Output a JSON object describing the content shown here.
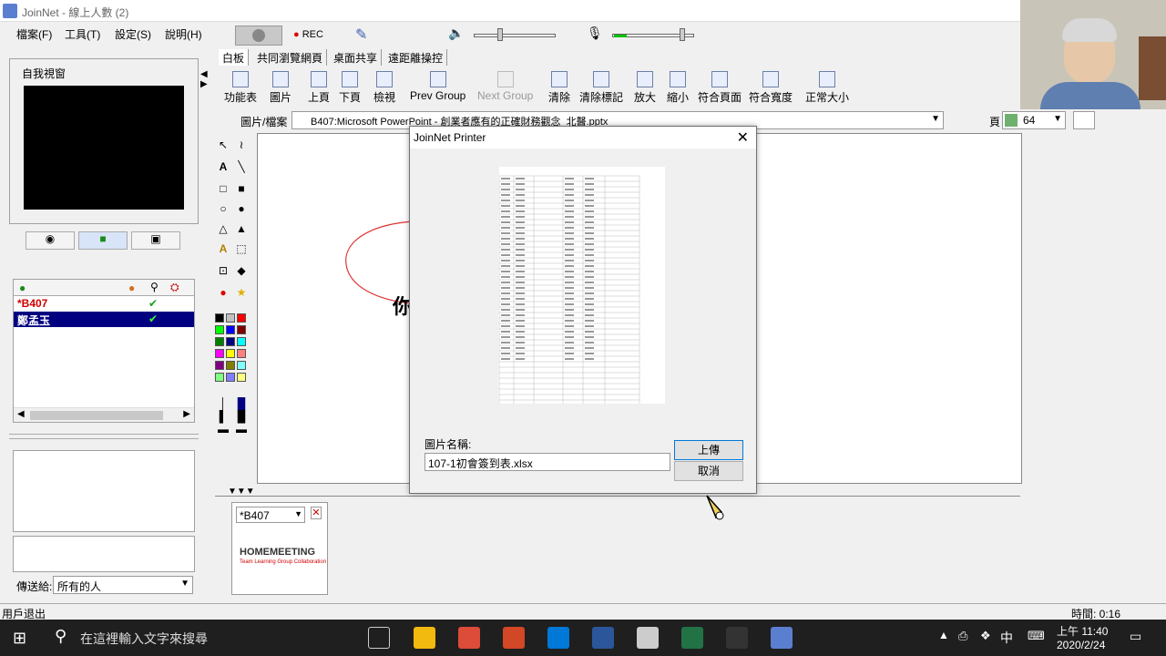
{
  "window": {
    "title": "JoinNet - 線上人數 (2)"
  },
  "menu": [
    "檔案(F)",
    "工具(T)",
    "設定(S)",
    "說明(H)"
  ],
  "toolbar": {
    "rec_label": "REC"
  },
  "tabs": [
    "白板",
    "共同瀏覽網頁",
    "桌面共享",
    "遠距離操控"
  ],
  "ribbon": [
    {
      "label": "功能表"
    },
    {
      "label": "圖片"
    },
    {
      "label": "上頁"
    },
    {
      "label": "下頁"
    },
    {
      "label": "檢視"
    },
    {
      "label": "Prev Group"
    },
    {
      "label": "Next Group",
      "disabled": true
    },
    {
      "label": "清除"
    },
    {
      "label": "清除標記"
    },
    {
      "label": "放大"
    },
    {
      "label": "縮小"
    },
    {
      "label": "符合頁面"
    },
    {
      "label": "符合寬度"
    },
    {
      "label": "正常大小"
    }
  ],
  "filebar": {
    "label": "圖片/檔案",
    "value": "B407:Microsoft PowerPoint - 創業者應有的正確財務觀念_北醫.pptx",
    "page_label": "頁",
    "page_value": "64"
  },
  "left": {
    "self_view_label": "自我視窗",
    "users": [
      {
        "name": "*B407",
        "check": "✔",
        "color": "#d00000",
        "selected": false
      },
      {
        "name": "鄭孟玉",
        "check": "✔",
        "color": "#ffffff",
        "selected": true
      }
    ],
    "send_to_label": "傳送給:",
    "send_to_value": "所有的人"
  },
  "canvas": {
    "partial_text": "你"
  },
  "bottom": {
    "user_select": "*B407",
    "logo_text": "HOMEMEETING",
    "logo_tagline": "Team Learning  Group Collaboration"
  },
  "status": {
    "left": "用戶退出",
    "right": "時間: 0:16"
  },
  "dialog": {
    "title": "JoinNet Printer",
    "name_label": "圖片名稱:",
    "name_value": "107-1初會簽到表.xlsx",
    "upload_label": "上傳",
    "cancel_label": "取消"
  },
  "taskbar": {
    "search_placeholder": "在這裡輸入文字來搜尋",
    "ime": "中",
    "time": "上午 11:40",
    "date": "2020/2/24",
    "app_icons": [
      {
        "name": "task-view-icon",
        "color": "#1f1f1f"
      },
      {
        "name": "file-explorer-icon",
        "color": "#f2b90f"
      },
      {
        "name": "chrome-icon",
        "color": "#dd4b39"
      },
      {
        "name": "powerpoint-icon",
        "color": "#d24726"
      },
      {
        "name": "store-icon",
        "color": "#0078d7"
      },
      {
        "name": "word-icon",
        "color": "#2b579a"
      },
      {
        "name": "mail-icon",
        "color": "#cccccc"
      },
      {
        "name": "excel-icon",
        "color": "#217346"
      },
      {
        "name": "7zip-icon",
        "color": "#333333"
      },
      {
        "name": "joinnet-icon",
        "color": "#5a7fd1"
      }
    ]
  },
  "palette": [
    "#000000",
    "#c0c0c0",
    "#ff0000",
    "#00ff00",
    "#0000ff",
    "#800000",
    "#008000",
    "#000080",
    "#00ffff",
    "#ff00ff",
    "#ffff00",
    "#ff8080",
    "#800080",
    "#808000",
    "#80ffff",
    "#80ff80",
    "#8080ff",
    "#ffff80"
  ]
}
